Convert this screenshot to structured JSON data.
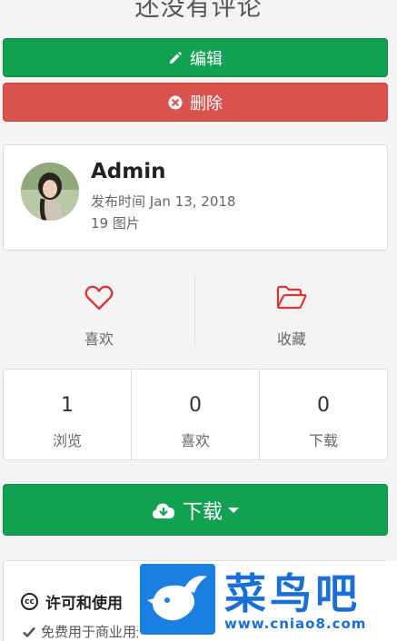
{
  "top_text": "还没有评论",
  "buttons": {
    "edit_label": "编辑",
    "delete_label": "删除",
    "download_label": "下载"
  },
  "author": {
    "name": "Admin",
    "date": "发布时间 Jan 13, 2018",
    "count": "19 图片"
  },
  "actions": {
    "like_label": "喜欢",
    "favorite_label": "收藏"
  },
  "stats": [
    {
      "value": "1",
      "label": "浏览"
    },
    {
      "value": "0",
      "label": "喜欢"
    },
    {
      "value": "0",
      "label": "下载"
    }
  ],
  "license": {
    "title": "许可和使用",
    "cc_badge": "cc",
    "item": "免费用于商业用途"
  },
  "watermark": {
    "text": "菜鸟吧",
    "url": "www.cniao8.com"
  },
  "colors": {
    "green": "#12a152",
    "red": "#d9534f",
    "icon_red": "#d9363a",
    "watermark_blue": "#1a6fd6"
  },
  "icons": [
    "pencil-icon",
    "times-circle-icon",
    "heart-icon",
    "folder-open-icon",
    "cloud-download-icon",
    "creative-commons-icon",
    "check-icon"
  ]
}
